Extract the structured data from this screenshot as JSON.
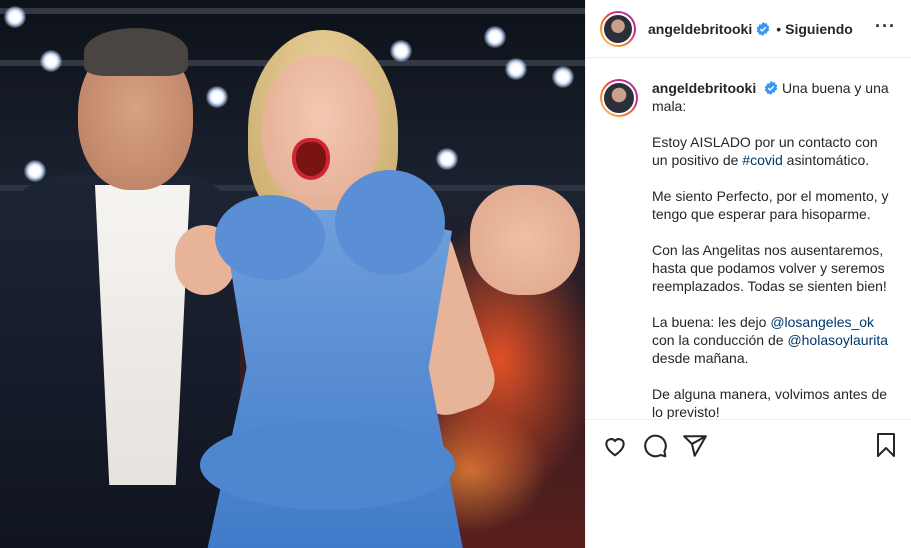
{
  "post": {
    "username": "angeldebritooki",
    "separator": "•",
    "follow_label": "Siguiendo",
    "more_label": "···",
    "caption": {
      "intro": "Una buena y una mala:",
      "p1_before": "Estoy AISLADO por un contacto con un positivo de ",
      "p1_hashtag": "#covid",
      "p1_after": " asintomático.",
      "p2": "Me siento Perfecto, por el momento, y tengo que esperar para hisoparme.",
      "p3": "Con las Angelitas nos ausentaremos, hasta que podamos volver y seremos reemplazados. Todas se sienten bien!",
      "p4_before": "La buena: les dejo ",
      "p4_mention1": "@losangeles_ok",
      "p4_middle": " con la conducción de ",
      "p4_mention2": "@holasoylaurita",
      "p4_after": " desde mañana.",
      "p5": "De alguna manera, volvimos antes de lo previsto!"
    }
  },
  "icons": {
    "verified": "verified-badge-icon",
    "like": "heart-icon",
    "comment": "comment-icon",
    "share": "share-icon",
    "save": "bookmark-icon"
  },
  "colors": {
    "text": "#262626",
    "link": "#00376b",
    "verified": "#3897f0",
    "border": "#efefef"
  }
}
